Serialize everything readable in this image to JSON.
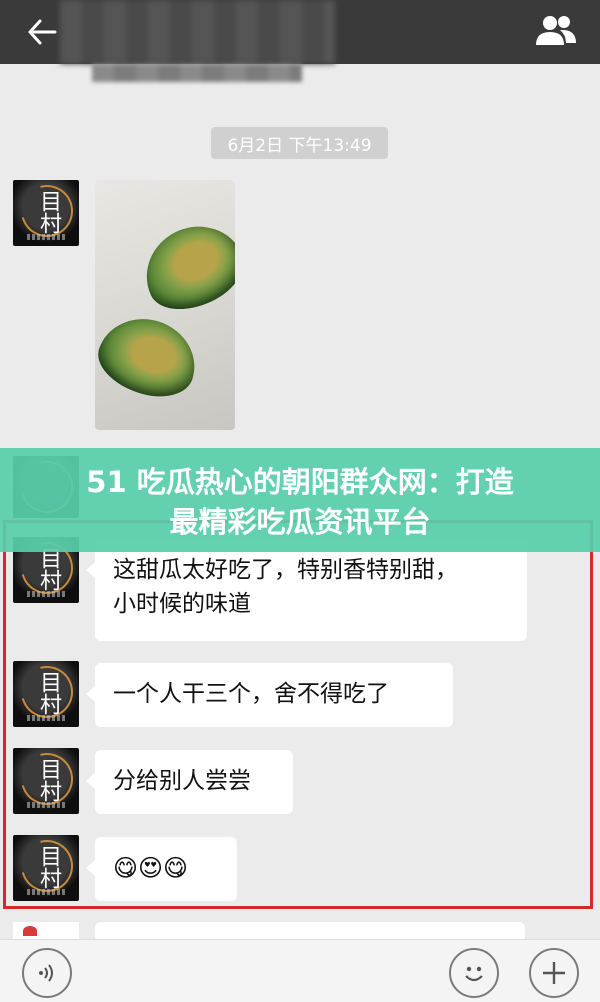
{
  "header": {
    "back_icon": "back-arrow-icon",
    "group_icon": "group-members-icon"
  },
  "timestamp": "6月2日 下午13:49",
  "sender": {
    "avatar_glyph": "目村"
  },
  "messages": [
    {
      "text": "这甜瓜太好吃了，特别香特别甜，\n小时候的味道"
    },
    {
      "text": "一个人干三个，舍不得吃了"
    },
    {
      "text": "分给别人尝尝"
    },
    {
      "text": "😋😍😋"
    }
  ],
  "banner": {
    "line1": "51 吃瓜热心的朝阳群众网：打造",
    "line2": "最精彩吃瓜资讯平台"
  },
  "highlight_color": "#d62a2a",
  "banner_color": "#58ceaa",
  "bottom_bar": {
    "voice_icon": "voice-icon",
    "emoji_icon": "emoji-icon",
    "plus_icon": "plus-icon"
  }
}
